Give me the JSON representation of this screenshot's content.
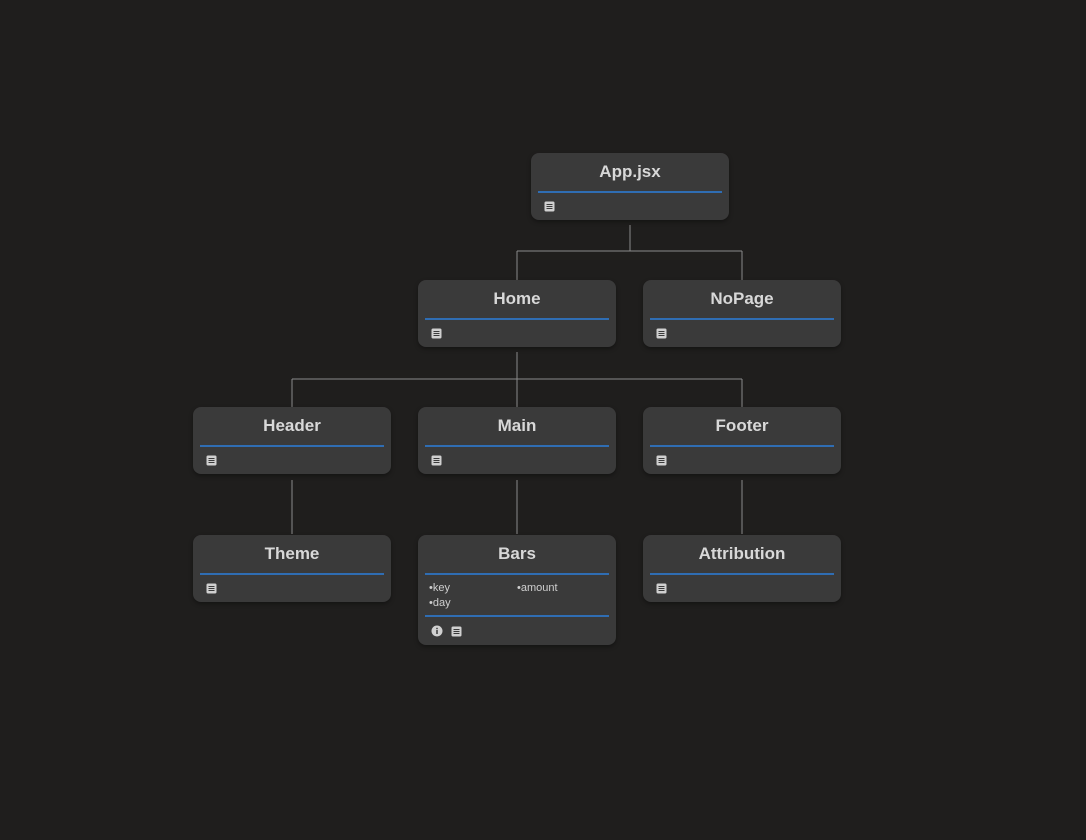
{
  "diagram": {
    "nodes": {
      "app": {
        "label": "App.jsx",
        "icons": [
          "document-icon"
        ]
      },
      "home": {
        "label": "Home",
        "icons": [
          "document-icon"
        ]
      },
      "nopage": {
        "label": "NoPage",
        "icons": [
          "document-icon"
        ]
      },
      "header": {
        "label": "Header",
        "icons": [
          "document-icon"
        ]
      },
      "main": {
        "label": "Main",
        "icons": [
          "document-icon"
        ]
      },
      "footer": {
        "label": "Footer",
        "icons": [
          "document-icon"
        ]
      },
      "theme": {
        "label": "Theme",
        "icons": [
          "document-icon"
        ]
      },
      "bars": {
        "label": "Bars",
        "props": [
          "•key",
          "•amount",
          "•day"
        ],
        "icons": [
          "info-icon",
          "document-icon"
        ]
      },
      "attribution": {
        "label": "Attribution",
        "icons": [
          "document-icon"
        ]
      }
    },
    "edges": [
      [
        "app",
        "home"
      ],
      [
        "app",
        "nopage"
      ],
      [
        "home",
        "header"
      ],
      [
        "home",
        "main"
      ],
      [
        "home",
        "footer"
      ],
      [
        "header",
        "theme"
      ],
      [
        "main",
        "bars"
      ],
      [
        "footer",
        "attribution"
      ]
    ],
    "colors": {
      "background": "#1f1e1d",
      "node": "#3a3a3a",
      "accent": "#2f6db3",
      "edge": "#8a8a8a",
      "text": "#d8d8d8"
    }
  }
}
